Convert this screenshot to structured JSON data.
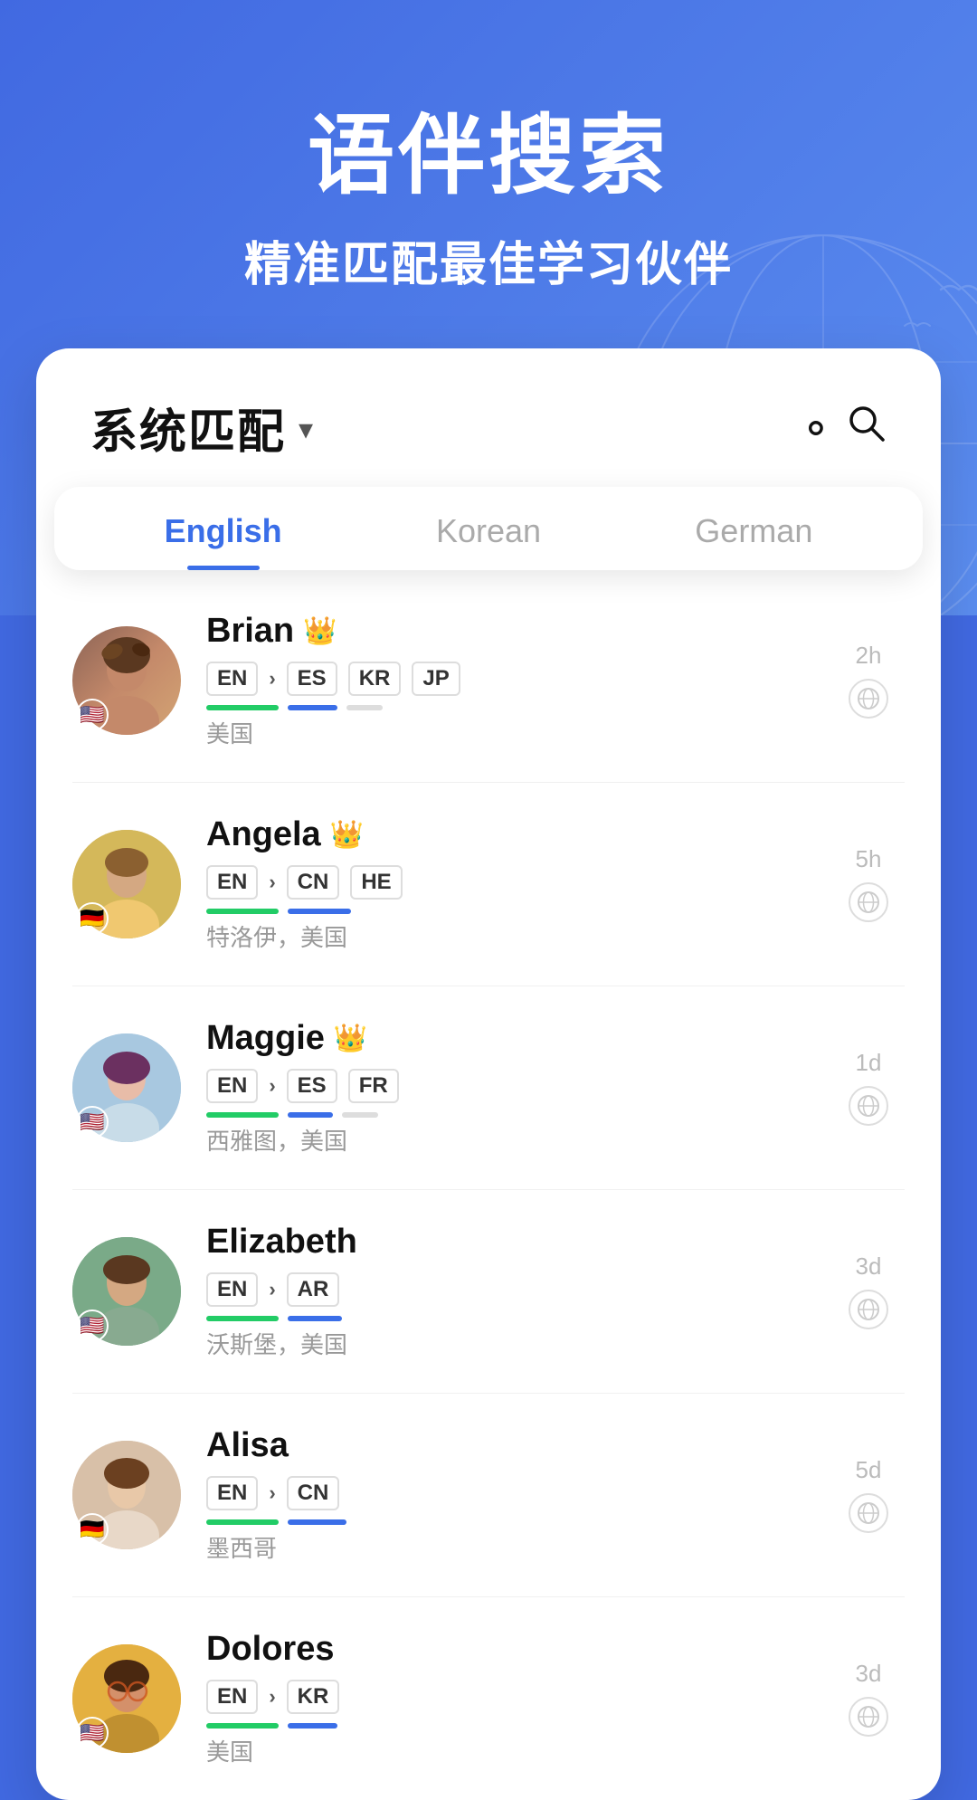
{
  "hero": {
    "title": "语伴搜索",
    "subtitle": "精准匹配最佳学习伙伴"
  },
  "card": {
    "match_label": "系统匹配",
    "chevron": "▾"
  },
  "tabs": [
    {
      "id": "english",
      "label": "English",
      "active": true
    },
    {
      "id": "korean",
      "label": "Korean",
      "active": false
    },
    {
      "id": "german",
      "label": "German",
      "active": false
    }
  ],
  "users": [
    {
      "name": "Brian",
      "crown": true,
      "from_lang": "EN",
      "to_langs": [
        "ES",
        "KR",
        "JP"
      ],
      "location": "美国",
      "time_ago": "2h",
      "flag": "🇺🇸",
      "avatar_class": "avatar-brian"
    },
    {
      "name": "Angela",
      "crown": true,
      "from_lang": "EN",
      "to_langs": [
        "CN",
        "HE"
      ],
      "location": "特洛伊，美国",
      "time_ago": "5h",
      "flag": "🇩🇪",
      "avatar_class": "avatar-angela"
    },
    {
      "name": "Maggie",
      "crown": true,
      "from_lang": "EN",
      "to_langs": [
        "ES",
        "FR"
      ],
      "location": "西雅图，美国",
      "time_ago": "1d",
      "flag": "🇺🇸",
      "avatar_class": "avatar-maggie"
    },
    {
      "name": "Elizabeth",
      "crown": false,
      "from_lang": "EN",
      "to_langs": [
        "AR"
      ],
      "location": "沃斯堡，美国",
      "time_ago": "3d",
      "flag": "🇺🇸",
      "avatar_class": "avatar-elizabeth"
    },
    {
      "name": "Alisa",
      "crown": false,
      "from_lang": "EN",
      "to_langs": [
        "CN"
      ],
      "location": "墨西哥",
      "time_ago": "5d",
      "flag": "🇩🇪",
      "avatar_class": "avatar-alisa"
    },
    {
      "name": "Dolores",
      "crown": false,
      "from_lang": "EN",
      "to_langs": [
        "KR"
      ],
      "location": "美国",
      "time_ago": "3d",
      "flag": "🇺🇸",
      "avatar_class": "avatar-dolores"
    }
  ],
  "icons": {
    "search": "🔍",
    "crown": "👑",
    "globe": "🌐"
  }
}
